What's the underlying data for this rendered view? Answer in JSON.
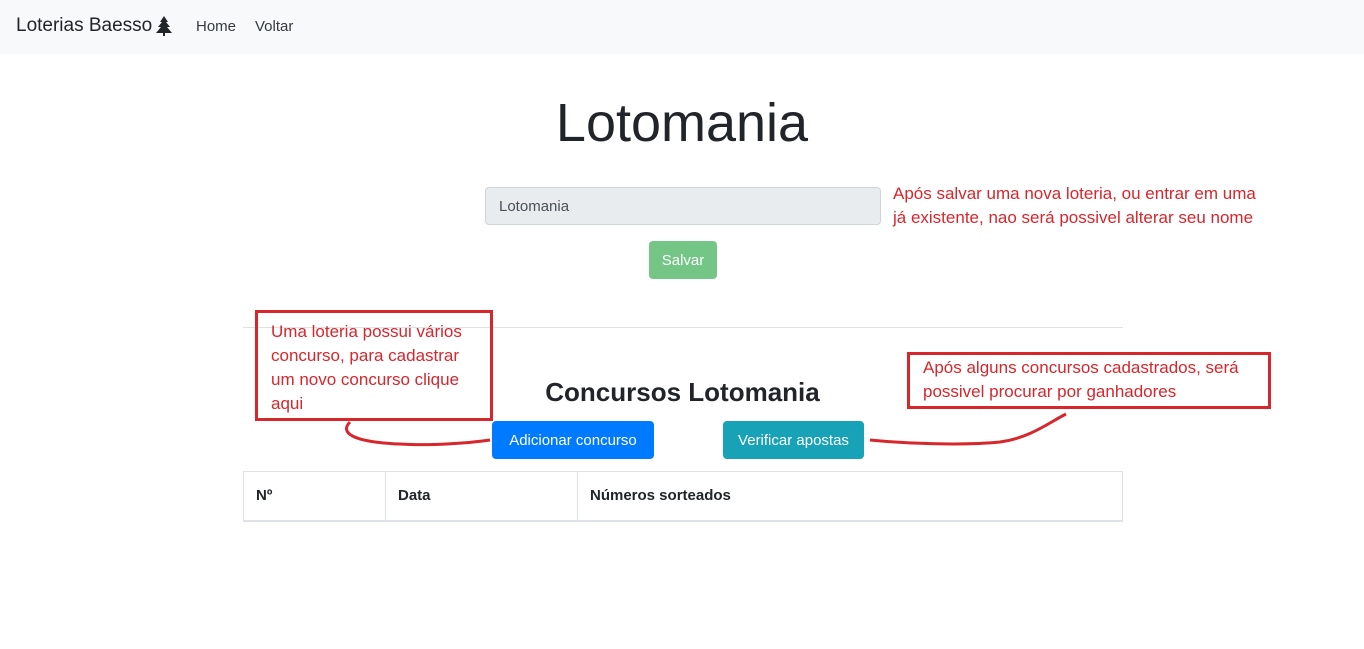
{
  "navbar": {
    "brand": "Loterias Baesso",
    "brand_icon": "tree-icon",
    "links": [
      "Home",
      "Voltar"
    ]
  },
  "page": {
    "title": "Lotomania"
  },
  "form": {
    "name_value": "Lotomania",
    "save_label": "Salvar"
  },
  "annotations": {
    "name_note": [
      "Após salvar uma nova loteria, ou entrar em uma",
      "já existente, nao será possivel alterar seu nome"
    ],
    "add_note": [
      "Uma loteria possui vários",
      "concurso, para cadastrar",
      "um novo concurso clique",
      "aqui"
    ],
    "verify_note": [
      "Após alguns concursos cadastrados, será",
      "possivel procurar por ganhadores"
    ],
    "color": "#d7262c"
  },
  "concursos": {
    "title": "Concursos Lotomania",
    "add_label": "Adicionar concurso",
    "verify_label": "Verificar apostas",
    "columns": [
      "Nº",
      "Data",
      "Números sorteados"
    ]
  },
  "colors": {
    "primary": "#007bff",
    "info": "#17a2b8",
    "success_disabled": "#74c687",
    "navbar_bg": "#f8f9fa"
  }
}
